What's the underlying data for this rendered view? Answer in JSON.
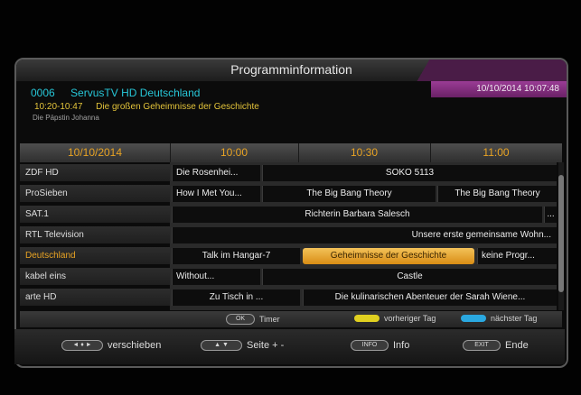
{
  "header": {
    "title": "Programminformation",
    "channel_number": "0006",
    "channel_name": "ServusTV HD Deutschland",
    "datetime": "10/10/2014   10:07:48",
    "current_time": "10:20-10:47",
    "current_title": "Die großen Geheimnisse der Geschichte",
    "next_title": "Die Päpstin Johanna"
  },
  "timeline": {
    "date": "10/10/2014",
    "slots": [
      "10:00",
      "10:30",
      "11:00"
    ]
  },
  "rows": [
    {
      "channel": "ZDF HD",
      "events": [
        {
          "title": "Die Rosenhei..."
        },
        {
          "title": "SOKO 5113"
        }
      ]
    },
    {
      "channel": "ProSieben",
      "events": [
        {
          "title": "How I Met You..."
        },
        {
          "title": "The Big Bang Theory"
        },
        {
          "title": "The Big Bang Theory"
        }
      ]
    },
    {
      "channel": "SAT.1",
      "events": [
        {
          "title": "Richterin Barbara Salesch"
        },
        {
          "title": "..."
        }
      ]
    },
    {
      "channel": "RTL Television",
      "events": [
        {
          "title": "Unsere erste gemeinsame Wohn..."
        }
      ]
    },
    {
      "channel": "Deutschland",
      "events": [
        {
          "title": "Talk im Hangar-7"
        },
        {
          "title": "Geheimnisse der Geschichte"
        },
        {
          "title": "keine Progr..."
        }
      ]
    },
    {
      "channel": "kabel eins",
      "events": [
        {
          "title": "Without..."
        },
        {
          "title": "Castle"
        }
      ]
    },
    {
      "channel": "arte HD",
      "events": [
        {
          "title": "Zu Tisch in ..."
        },
        {
          "title": "Die kulinarischen Abenteuer der Sarah Wiene..."
        }
      ]
    }
  ],
  "legend": {
    "ok_key": "OK",
    "timer": "Timer",
    "prev_day": "vorheriger Tag",
    "next_day": "nächster Tag",
    "yellow": "#e0d020",
    "blue": "#2aa8e0"
  },
  "footer": {
    "move_key": "◄ ♦ ►",
    "move": "verschieben",
    "page_key": "▲ ▼",
    "page": "Seite + -",
    "info_key": "INFO",
    "info": "Info",
    "exit_key": "EXIT",
    "exit": "Ende"
  }
}
